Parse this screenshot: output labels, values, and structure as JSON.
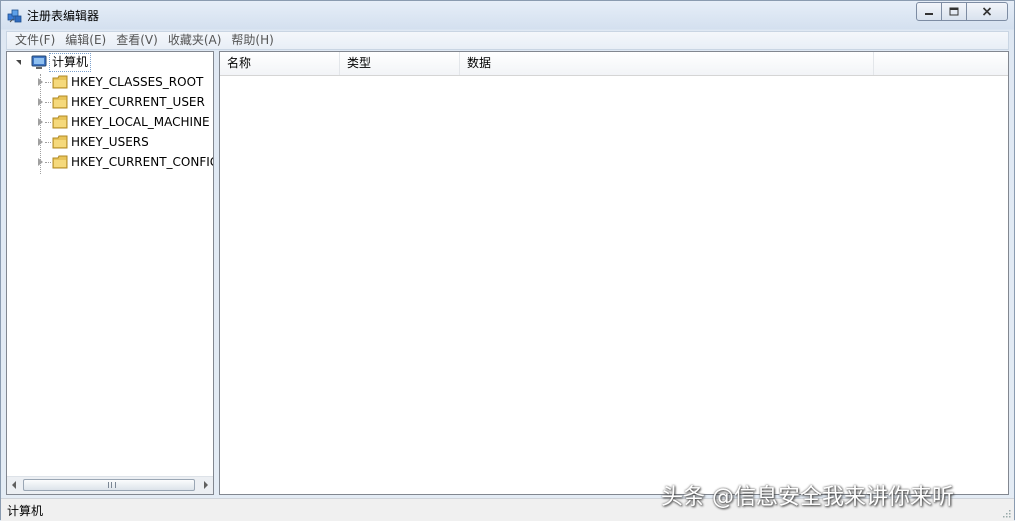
{
  "window": {
    "title": "注册表编辑器",
    "app_icon": "registry-editor-icon",
    "buttons": {
      "minimize_icon": "minimize-icon",
      "maximize_icon": "maximize-icon",
      "close_icon": "close-icon"
    }
  },
  "menu": {
    "items": [
      {
        "label": "文件(F)"
      },
      {
        "label": "编辑(E)"
      },
      {
        "label": "查看(V)"
      },
      {
        "label": "收藏夹(A)"
      },
      {
        "label": "帮助(H)"
      }
    ]
  },
  "tree": {
    "root": {
      "label": "计算机",
      "icon": "computer-icon",
      "expanded": true
    },
    "keys": [
      {
        "label": "HKEY_CLASSES_ROOT",
        "icon": "folder-icon"
      },
      {
        "label": "HKEY_CURRENT_USER",
        "icon": "folder-icon"
      },
      {
        "label": "HKEY_LOCAL_MACHINE",
        "icon": "folder-icon"
      },
      {
        "label": "HKEY_USERS",
        "icon": "folder-icon"
      },
      {
        "label": "HKEY_CURRENT_CONFIG",
        "icon": "folder-icon"
      }
    ]
  },
  "list": {
    "columns": [
      {
        "label": "名称"
      },
      {
        "label": "类型"
      },
      {
        "label": "数据"
      }
    ]
  },
  "status": {
    "text": "计算机"
  },
  "watermark": {
    "text": "头条 @信息安全我来讲你来听"
  },
  "colors": {
    "folder": "#e8c45a",
    "selection_border": "#7da2ce"
  }
}
